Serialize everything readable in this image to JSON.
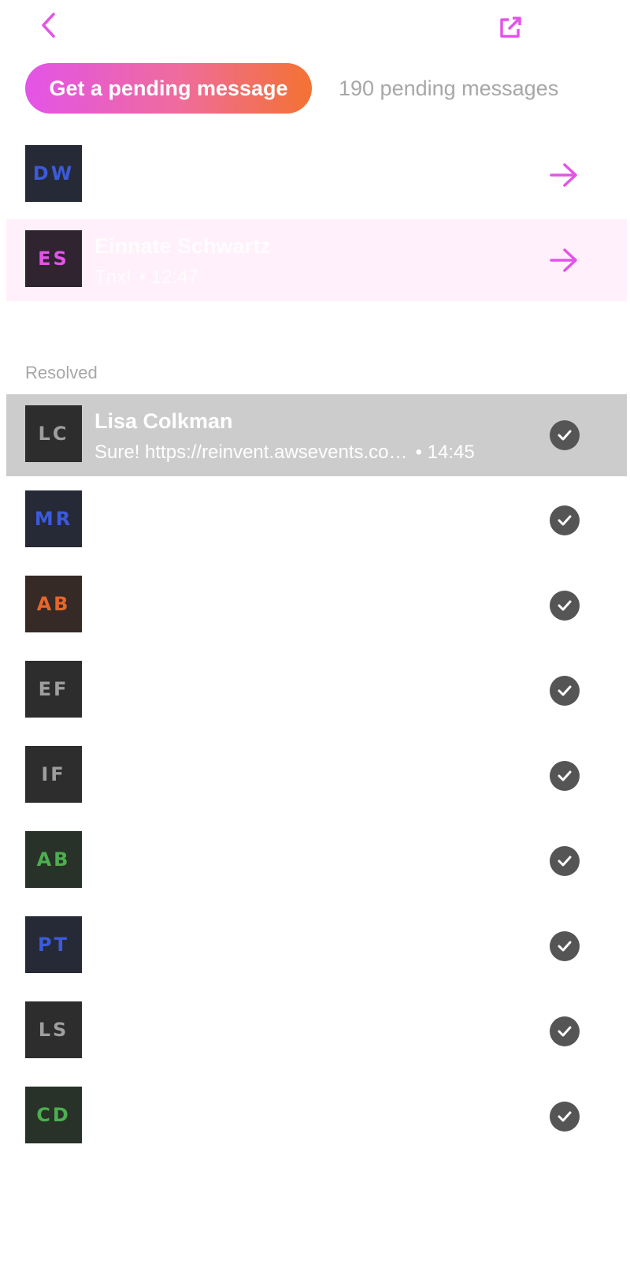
{
  "header": {
    "back_icon": "chevron-left-icon",
    "popout_icon": "external-link-icon",
    "accent": "#e354e8"
  },
  "actions": {
    "get_pending_label": "Get a pending message",
    "pending_count_text": "190 pending messages"
  },
  "pending": [
    {
      "initials": "DW",
      "fg": "#3b5bdb",
      "bg": "#262a36",
      "name": "",
      "preview": "",
      "time": ""
    },
    {
      "initials": "ES",
      "fg": "#e354e8",
      "bg": "#2f2430",
      "name": "Einnate Schwartz",
      "preview": "Tnx!",
      "time": "• 12:47"
    }
  ],
  "resolved_label": "Resolved",
  "resolved": [
    {
      "initials": "LC",
      "fg": "#9e9e9e",
      "bg": "#2d2d2d",
      "name": "Lisa Colkman",
      "preview": "Sure! https://reinvent.awsevents.co…",
      "time": "• 14:45"
    },
    {
      "initials": "MR",
      "fg": "#3b5bdb",
      "bg": "#262a36",
      "name": "",
      "preview": "",
      "time": ""
    },
    {
      "initials": "AB",
      "fg": "#e8652a",
      "bg": "#362a26",
      "name": "",
      "preview": "",
      "time": ""
    },
    {
      "initials": "EF",
      "fg": "#9e9e9e",
      "bg": "#2d2d2d",
      "name": "",
      "preview": "",
      "time": ""
    },
    {
      "initials": "IF",
      "fg": "#9e9e9e",
      "bg": "#2d2d2d",
      "name": "",
      "preview": "",
      "time": ""
    },
    {
      "initials": "AB",
      "fg": "#4caf50",
      "bg": "#283228",
      "name": "",
      "preview": "",
      "time": ""
    },
    {
      "initials": "PT",
      "fg": "#3b5bdb",
      "bg": "#262a36",
      "name": "",
      "preview": "",
      "time": ""
    },
    {
      "initials": "LS",
      "fg": "#9e9e9e",
      "bg": "#2d2d2d",
      "name": "",
      "preview": "",
      "time": ""
    },
    {
      "initials": "CD",
      "fg": "#4caf50",
      "bg": "#283228",
      "name": "",
      "preview": "",
      "time": ""
    }
  ]
}
